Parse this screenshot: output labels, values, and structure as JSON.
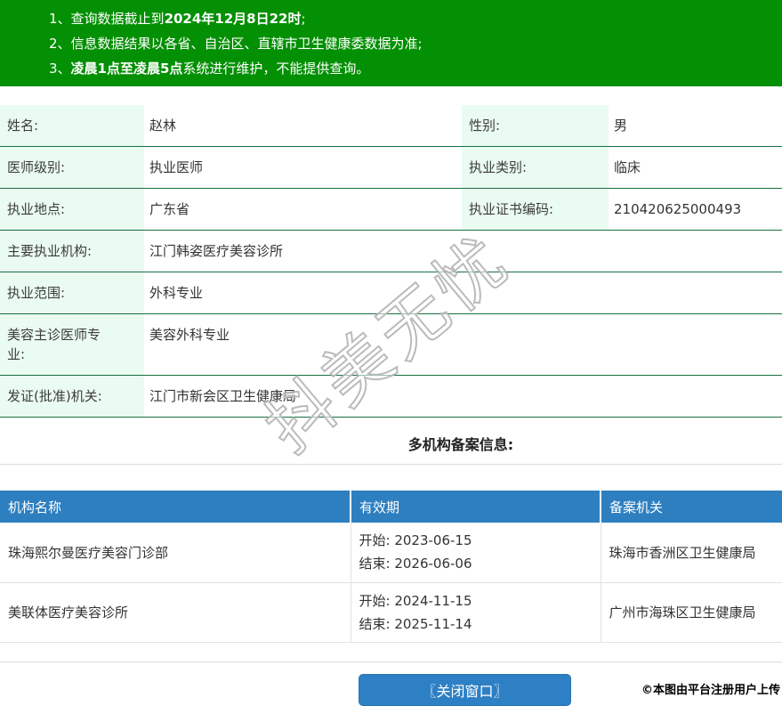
{
  "notice": {
    "items": [
      {
        "num": "1、",
        "part1": "查询数据截止到",
        "bold": "2024年12月8日22时",
        "part3": ";"
      },
      {
        "num": "2、",
        "part1": "信息数据结果以各省、自治区、直辖市卫生健康委数据为准;",
        "bold": "",
        "part3": ""
      },
      {
        "num": "3、",
        "part1": "",
        "bold": "凌晨1点至凌晨5点",
        "part3": "系统进行维护，不能提供查询。"
      }
    ]
  },
  "info": {
    "rows": [
      {
        "label1": "姓名:",
        "value1": "赵林",
        "label2": "性别:",
        "value2": "男"
      },
      {
        "label1": "医师级别:",
        "value1": "执业医师",
        "label2": "执业类别:",
        "value2": "临床"
      },
      {
        "label1": "执业地点:",
        "value1": "广东省",
        "label2": "执业证书编码:",
        "value2": "210420625000493"
      },
      {
        "label1": "主要执业机构:",
        "value1": "江门韩姿医疗美容诊所"
      },
      {
        "label1": "执业范围:",
        "value1": "外科专业"
      },
      {
        "label1": "美容主诊医师专业:",
        "value1": "美容外科专业"
      },
      {
        "label1": "发证(批准)机关:",
        "value1": "江门市新会区卫生健康局"
      }
    ]
  },
  "section_title": "多机构备案信息:",
  "org_table": {
    "headers": [
      "机构名称",
      "有效期",
      "备案机关"
    ],
    "rows": [
      {
        "name": "珠海熙尔曼医疗美容门诊部",
        "start_text": "开始: 2023-06-15",
        "end_text": "结束: 2026-06-06",
        "authority": "珠海市香洲区卫生健康局"
      },
      {
        "name": "美联体医疗美容诊所",
        "start_text": "开始: 2024-11-15",
        "end_text": "结束: 2025-11-14",
        "authority": "广州市海珠区卫生健康局"
      }
    ]
  },
  "actions": {
    "close_label": "〖关闭窗口〗"
  },
  "watermark": {
    "text": "抖美无忧"
  },
  "footer": {
    "credit": "©本图由平台注册用户上传"
  },
  "colors": {
    "banner_green": "#049004",
    "row_border_green": "#176f42",
    "label_bg_green": "#eafbf1",
    "header_blue": "#2e7fc0",
    "button_blue": "#2e80c4"
  }
}
